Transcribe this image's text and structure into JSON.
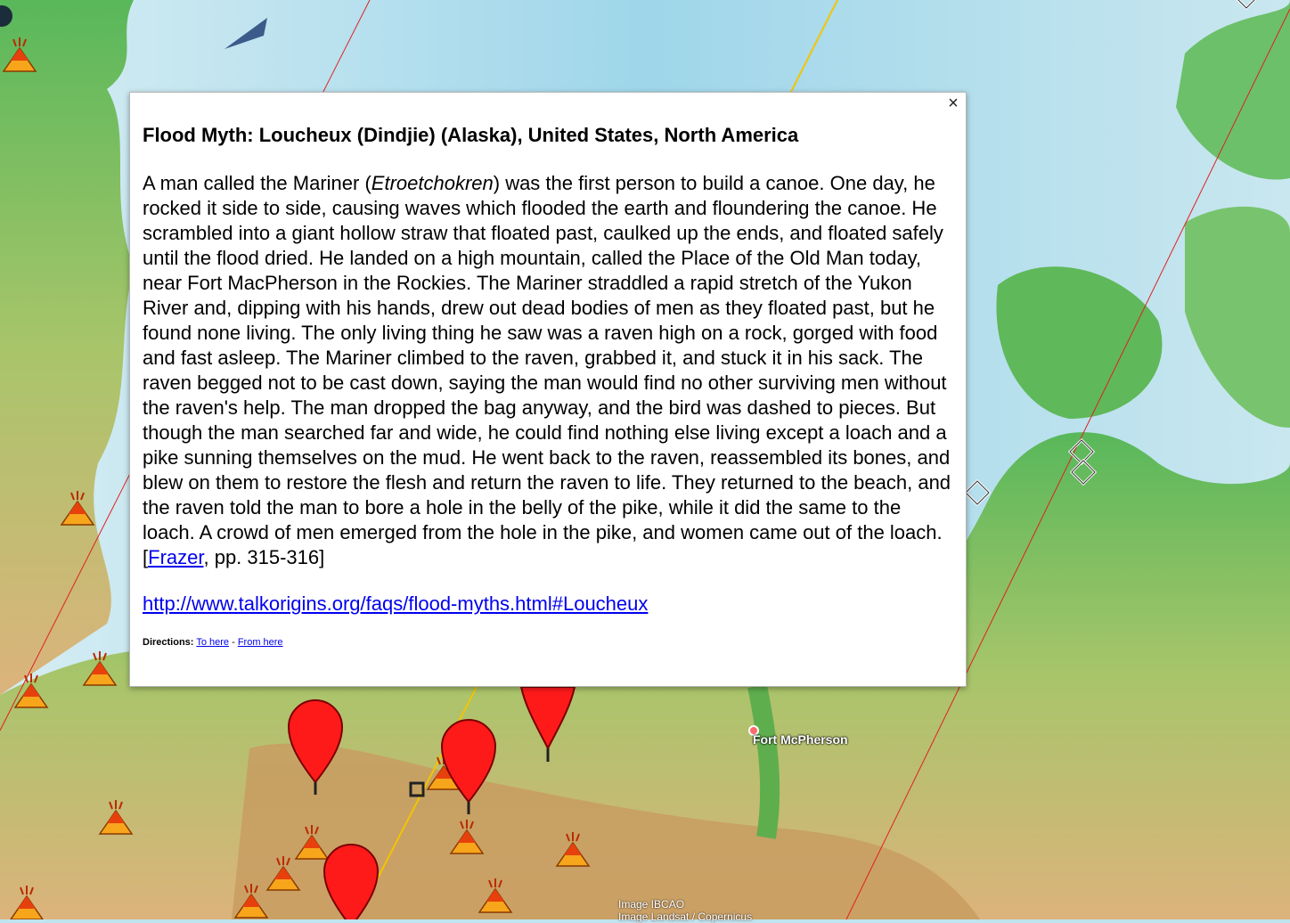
{
  "popup": {
    "title": "Flood Myth: Loucheux (Dindjie) (Alaska), United States, North America",
    "close": "×",
    "text_before_italic": "A man called the Mariner (",
    "italic": "Etroetchokren",
    "text_after_italic": ") was the first person to build a canoe. One day, he rocked it side to side, causing waves which flooded the earth and floundering the canoe. He scrambled into a giant hollow straw that floated past, caulked up the ends, and floated safely until the flood dried. He landed on a high mountain, called the Place of the Old Man today, near Fort MacPherson in the Rockies. The Mariner straddled a rapid stretch of the Yukon River and, dipping with his hands, drew out dead bodies of men as they floated past, but he found none living. The only living thing he saw was a raven high on a rock, gorged with food and fast asleep. The Mariner climbed to the raven, grabbed it, and stuck it in his sack. The raven begged not to be cast down, saying the man would find no other surviving men without the raven's help. The man dropped the bag anyway, and the bird was dashed to pieces. But though the man searched far and wide, he could find nothing else living except a loach and a pike sunning themselves on the mud. He went back to the raven, reassembled its bones, and blew on them to restore the flesh and return the raven to life. They returned to the beach, and the raven told the man to bore a hole in the belly of the pike, while it did the same to the loach. A crowd of men emerged from the hole in the pike, and women came out of the loach. [",
    "citation_link": "Frazer",
    "citation_rest": ", pp. 315-316]",
    "url": "http://www.talkorigins.org/faqs/flood-myths.html#Loucheux",
    "directions_label": "Directions:",
    "to_here": "To here",
    "separator": " - ",
    "from_here": "From here"
  },
  "map": {
    "place_label": "Fort McPherson",
    "attribution_line1": "Image IBCAO",
    "attribution_line2": "Image Landsat / Copernicus",
    "colors": {
      "ocean": "#bfe3ef",
      "lowland": "#5fb85a",
      "highland": "#d9b07a",
      "pin": "#ff1a1a"
    },
    "icons": [
      "volcano-icon",
      "map-pin-icon",
      "diamond-marker-icon"
    ]
  }
}
